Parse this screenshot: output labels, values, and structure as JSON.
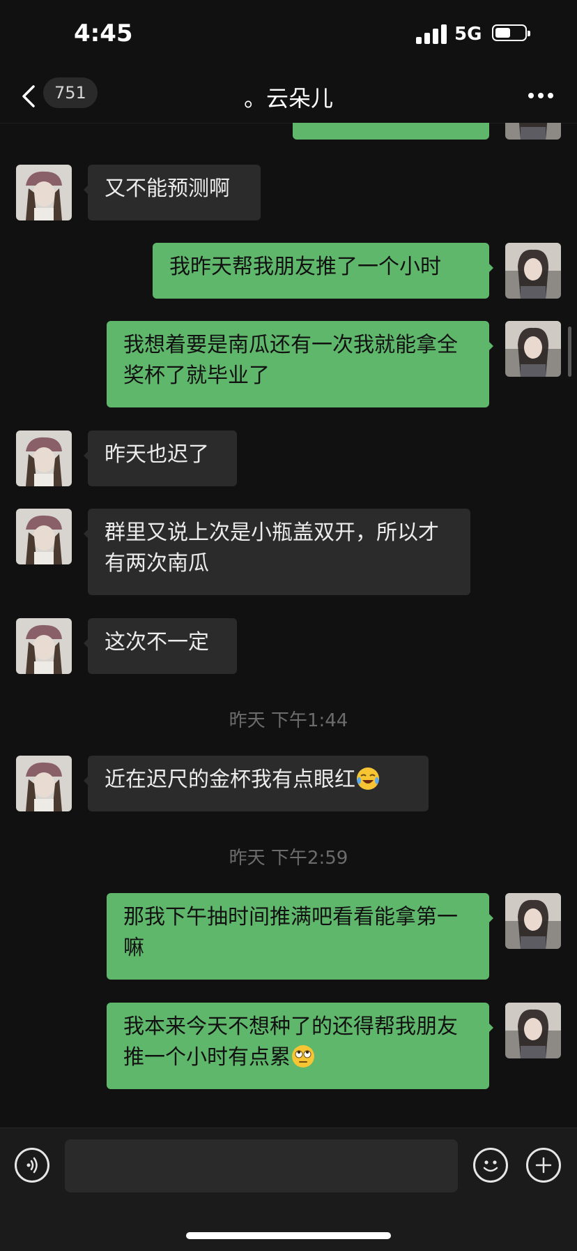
{
  "status_bar": {
    "time": "4:45",
    "network": "5G",
    "battery_level": 0.45
  },
  "nav": {
    "back_icon": "chevron-left-icon",
    "unread_count": "751",
    "title": "。云朵儿",
    "more_icon": "ellipsis-icon"
  },
  "messages": [
    {
      "side": "right",
      "text": "",
      "partial": true
    },
    {
      "side": "left",
      "text": "又不能预测啊"
    },
    {
      "side": "right",
      "text": "我昨天帮我朋友推了一个小时"
    },
    {
      "side": "right",
      "text": "我想着要是南瓜还有一次我就能拿全奖杯了就毕业了"
    },
    {
      "side": "left",
      "text": "昨天也迟了"
    },
    {
      "side": "left",
      "text": "群里又说上次是小瓶盖双开，所以才有两次南瓜"
    },
    {
      "side": "left",
      "text": "这次不一定"
    },
    {
      "timestamp": "昨天 下午1:44"
    },
    {
      "side": "left",
      "text": "近在迟尺的金杯我有点眼红",
      "emoji": "face-with-tears-icon"
    },
    {
      "timestamp": "昨天 下午2:59"
    },
    {
      "side": "right",
      "text": "那我下午抽时间推满吧看看能拿第一嘛"
    },
    {
      "side": "right",
      "text": "我本来今天不想种了的还得帮我朋友推一个小时有点累",
      "emoji": "rolling-eyes-face-icon"
    }
  ],
  "input_bar": {
    "voice_icon": "voice-icon",
    "message_placeholder": "",
    "emoji_icon": "emoji-icon",
    "plus_icon": "plus-icon"
  },
  "colors": {
    "background": "#111111",
    "incoming_bubble": "#2b2b2b",
    "outgoing_bubble": "#5fb76b",
    "timestamp": "#6c6c6c"
  }
}
